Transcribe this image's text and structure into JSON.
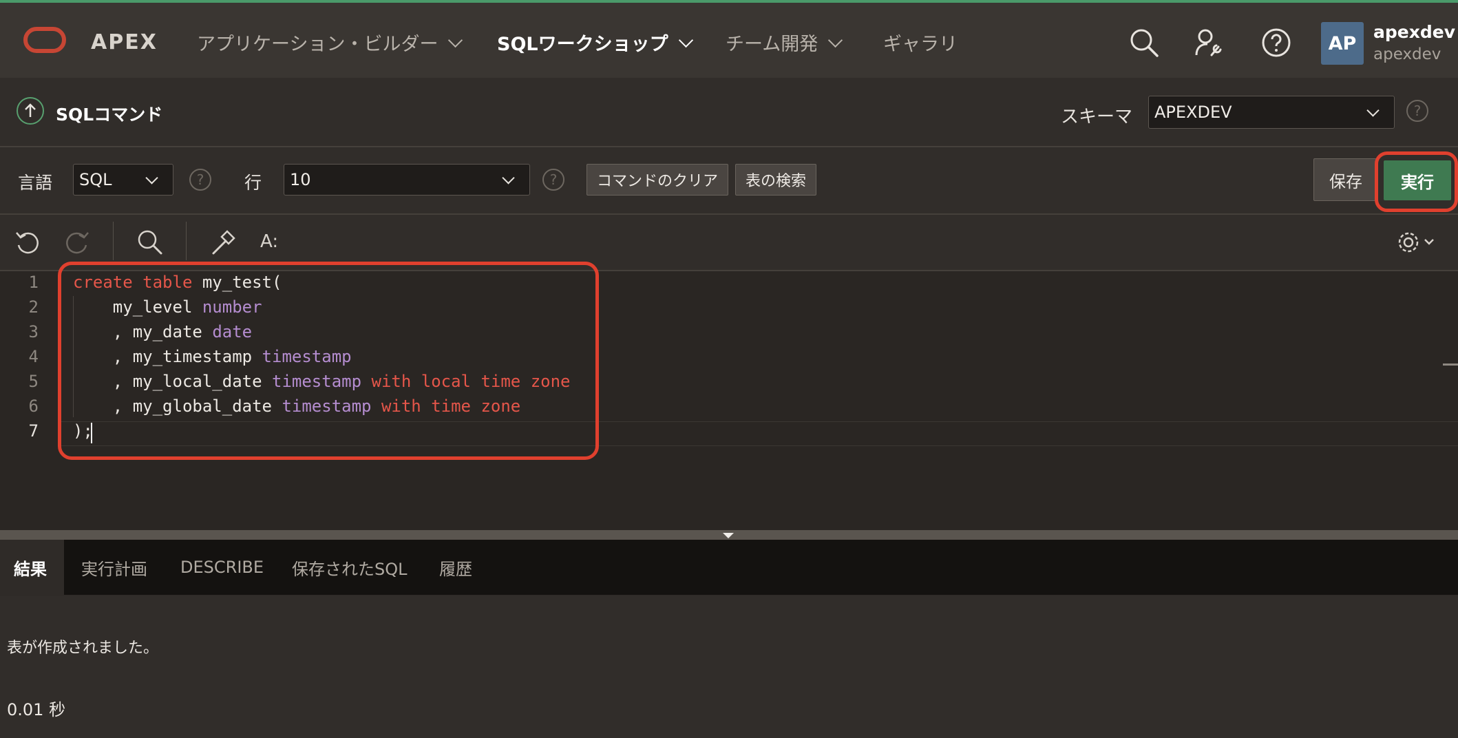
{
  "colors": {
    "brand": "#c74634",
    "accent": "#3f7a51",
    "highlight": "#e0402e",
    "keyword": "#e5564a",
    "type": "#b58dd0"
  },
  "header": {
    "app_name": "APEX",
    "nav": [
      {
        "label": "アプリケーション・ビルダー"
      },
      {
        "label": "SQLワークショップ"
      },
      {
        "label": "チーム開発"
      },
      {
        "label": "ギャラリ"
      }
    ],
    "icons": [
      "search-icon",
      "user-settings-icon",
      "help-icon"
    ],
    "user": {
      "initials": "AP",
      "name": "apexdev",
      "workspace": "apexdev"
    }
  },
  "command_bar": {
    "title": "SQLコマンド",
    "schema_label": "スキーマ",
    "schema_value": "APEXDEV"
  },
  "options": {
    "language_label": "言語",
    "language_value": "SQL",
    "rows_label": "行",
    "rows_value": "10",
    "clear_button": "コマンドのクリア",
    "find_tables_button": "表の検索",
    "save_button": "保存",
    "run_button": "実行"
  },
  "toolbar": {
    "icons": [
      "undo-icon",
      "redo-icon",
      "search-icon",
      "hammer-icon",
      "font-size-icon",
      "gear-icon"
    ],
    "font_label": "A:"
  },
  "editor": {
    "line_numbers": [
      "1",
      "2",
      "3",
      "4",
      "5",
      "6",
      "7"
    ],
    "lines": [
      "create table my_test(",
      "    my_level number",
      "    , my_date date",
      "    , my_timestamp timestamp",
      "    , my_local_date timestamp with local time zone",
      "    , my_global_date timestamp with time zone",
      ");"
    ]
  },
  "results": {
    "tabs": [
      {
        "label": "結果"
      },
      {
        "label": "実行計画"
      },
      {
        "label": "DESCRIBE"
      },
      {
        "label": "保存されたSQL"
      },
      {
        "label": "履歴"
      }
    ],
    "message": "表が作成されました。",
    "elapsed": "0.01 秒"
  }
}
